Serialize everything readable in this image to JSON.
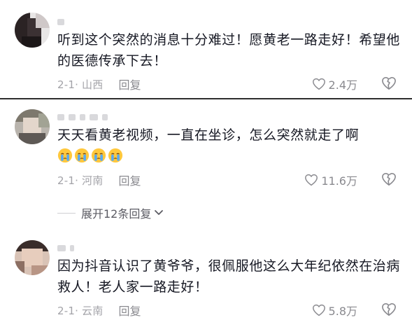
{
  "comments": [
    {
      "text": "听到这个突然的消息十分难过！愿黄老一路走好！希望他的医德传承下去！",
      "date": "2-1· 山西",
      "reply_label": "回复",
      "likes": "2.4万"
    },
    {
      "text": "天天看黄老视频，一直在坐诊，怎么突然就走了啊",
      "emoji_count": 4,
      "emoji_icon": "crying-face-icon",
      "date": "2-1· 河南",
      "reply_label": "回复",
      "likes": "11.6万",
      "expand_label": "展开12条回复"
    },
    {
      "text": "因为抖音认识了黄爷爷，很佩服他这么大年纪依然在治病救人！老人家一路走好！",
      "date": "2-1· 云南",
      "reply_label": "回复",
      "likes": "5.8万"
    }
  ],
  "icons": {
    "like": "heart-outline-icon",
    "dislike": "broken-heart-icon",
    "expand": "chevron-down-icon"
  },
  "colors": {
    "text": "#161823",
    "meta": "#a3a3a8",
    "divider": "#2d2d2d"
  }
}
